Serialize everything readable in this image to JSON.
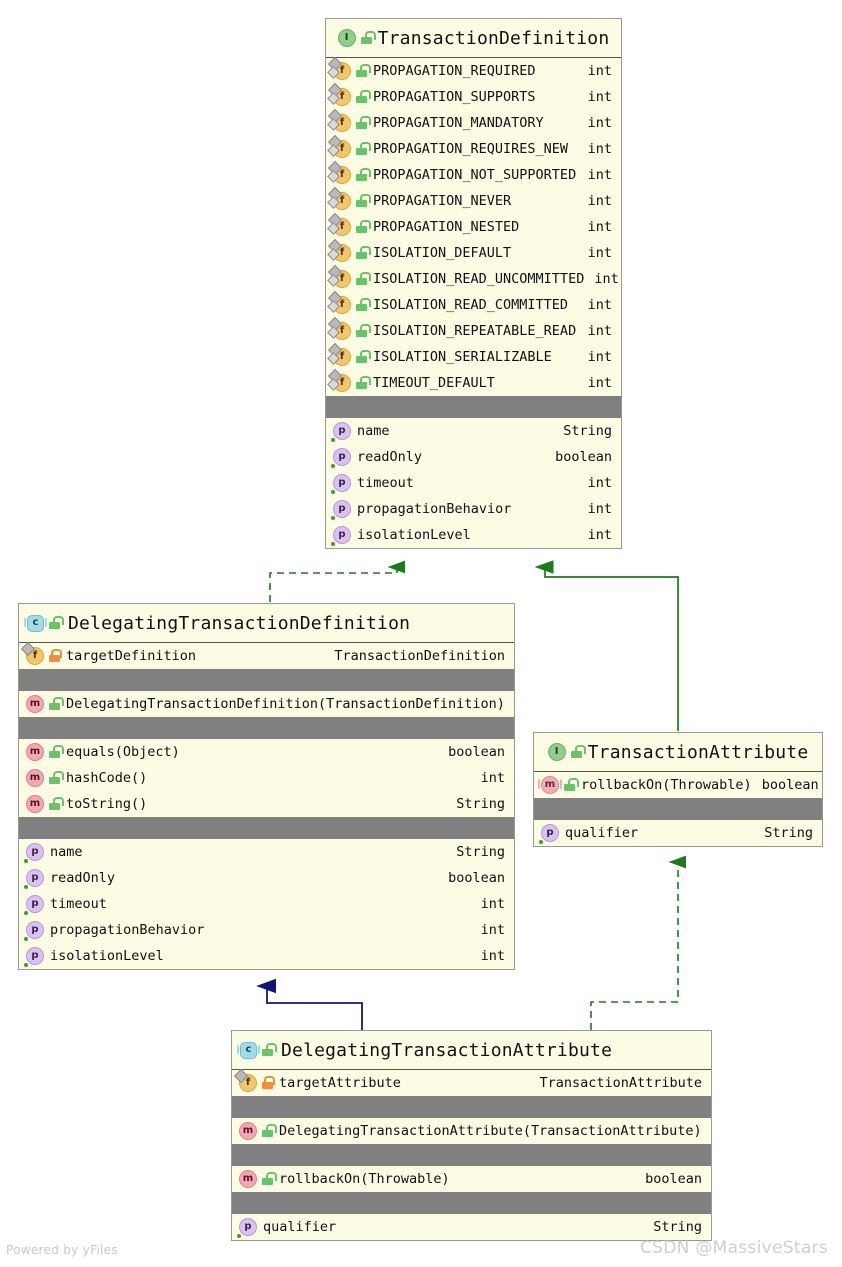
{
  "diagram": {
    "kind": "uml-class-diagram",
    "watermark_left": "Powered by yFiles",
    "watermark_right": "CSDN @MassiveStars",
    "colors": {
      "box_fill": "#fcfce4",
      "box_border": "#9a9a8f",
      "separator_bar": "#808080",
      "interface_icon": "#8fcf8a",
      "class_icon": "#9fdce8",
      "field_icon": "#f3c66a",
      "method_icon": "#f3a7b4",
      "property_icon": "#d9c2ef",
      "public_lock": "#6cc26c",
      "protected_lock": "#ef8f3c",
      "realization_edge": "#1d7a1d",
      "generalization_edge": "#141478"
    }
  },
  "nodes": {
    "transaction_definition": {
      "stereotype": "interface",
      "icon": "interface-icon",
      "visibility": "public",
      "name": "TransactionDefinition",
      "fields": [
        {
          "icon": "static-field-icon",
          "visibility": "public",
          "name": "PROPAGATION_REQUIRED",
          "type": "int"
        },
        {
          "icon": "static-field-icon",
          "visibility": "public",
          "name": "PROPAGATION_SUPPORTS",
          "type": "int"
        },
        {
          "icon": "static-field-icon",
          "visibility": "public",
          "name": "PROPAGATION_MANDATORY",
          "type": "int"
        },
        {
          "icon": "static-field-icon",
          "visibility": "public",
          "name": "PROPAGATION_REQUIRES_NEW",
          "type": "int"
        },
        {
          "icon": "static-field-icon",
          "visibility": "public",
          "name": "PROPAGATION_NOT_SUPPORTED",
          "type": "int"
        },
        {
          "icon": "static-field-icon",
          "visibility": "public",
          "name": "PROPAGATION_NEVER",
          "type": "int"
        },
        {
          "icon": "static-field-icon",
          "visibility": "public",
          "name": "PROPAGATION_NESTED",
          "type": "int"
        },
        {
          "icon": "static-field-icon",
          "visibility": "public",
          "name": "ISOLATION_DEFAULT",
          "type": "int"
        },
        {
          "icon": "static-field-icon",
          "visibility": "public",
          "name": "ISOLATION_READ_UNCOMMITTED",
          "type": "int"
        },
        {
          "icon": "static-field-icon",
          "visibility": "public",
          "name": "ISOLATION_READ_COMMITTED",
          "type": "int"
        },
        {
          "icon": "static-field-icon",
          "visibility": "public",
          "name": "ISOLATION_REPEATABLE_READ",
          "type": "int"
        },
        {
          "icon": "static-field-icon",
          "visibility": "public",
          "name": "ISOLATION_SERIALIZABLE",
          "type": "int"
        },
        {
          "icon": "static-field-icon",
          "visibility": "public",
          "name": "TIMEOUT_DEFAULT",
          "type": "int"
        }
      ],
      "properties": [
        {
          "icon": "property-icon",
          "name": "name",
          "type": "String"
        },
        {
          "icon": "property-icon",
          "name": "readOnly",
          "type": "boolean"
        },
        {
          "icon": "property-icon",
          "name": "timeout",
          "type": "int"
        },
        {
          "icon": "property-icon",
          "name": "propagationBehavior",
          "type": "int"
        },
        {
          "icon": "property-icon",
          "name": "isolationLevel",
          "type": "int"
        }
      ]
    },
    "delegating_transaction_definition": {
      "stereotype": "class",
      "icon": "class-icon",
      "visibility": "public",
      "name": "DelegatingTransactionDefinition",
      "fields": [
        {
          "icon": "field-icon",
          "visibility": "protected",
          "name": "targetDefinition",
          "type": "TransactionDefinition"
        }
      ],
      "constructors": [
        {
          "icon": "method-icon",
          "visibility": "public",
          "name": "DelegatingTransactionDefinition(TransactionDefinition)",
          "type": ""
        }
      ],
      "methods": [
        {
          "icon": "method-icon",
          "visibility": "public",
          "name": "equals(Object)",
          "type": "boolean"
        },
        {
          "icon": "method-icon",
          "visibility": "public",
          "name": "hashCode()",
          "type": "int"
        },
        {
          "icon": "method-icon",
          "visibility": "public",
          "name": "toString()",
          "type": "String"
        }
      ],
      "properties": [
        {
          "icon": "property-icon",
          "name": "name",
          "type": "String"
        },
        {
          "icon": "property-icon",
          "name": "readOnly",
          "type": "boolean"
        },
        {
          "icon": "property-icon",
          "name": "timeout",
          "type": "int"
        },
        {
          "icon": "property-icon",
          "name": "propagationBehavior",
          "type": "int"
        },
        {
          "icon": "property-icon",
          "name": "isolationLevel",
          "type": "int"
        }
      ]
    },
    "transaction_attribute": {
      "stereotype": "interface",
      "icon": "interface-icon",
      "visibility": "public",
      "name": "TransactionAttribute",
      "methods": [
        {
          "icon": "abstract-method-icon",
          "visibility": "public",
          "name": "rollbackOn(Throwable)",
          "type": "boolean"
        }
      ],
      "properties": [
        {
          "icon": "property-icon",
          "name": "qualifier",
          "type": "String"
        }
      ]
    },
    "delegating_transaction_attribute": {
      "stereotype": "class",
      "icon": "class-icon",
      "visibility": "public",
      "name": "DelegatingTransactionAttribute",
      "fields": [
        {
          "icon": "field-icon",
          "visibility": "protected",
          "name": "targetAttribute",
          "type": "TransactionAttribute"
        }
      ],
      "constructors": [
        {
          "icon": "method-icon",
          "visibility": "public",
          "name": "DelegatingTransactionAttribute(TransactionAttribute)",
          "type": ""
        }
      ],
      "methods": [
        {
          "icon": "method-icon",
          "visibility": "public",
          "name": "rollbackOn(Throwable)",
          "type": "boolean"
        }
      ],
      "properties": [
        {
          "icon": "property-icon",
          "name": "qualifier",
          "type": "String"
        }
      ]
    }
  },
  "edges": [
    {
      "from": "delegating_transaction_definition",
      "to": "transaction_definition",
      "type": "realization",
      "style": "dashed",
      "color": "#1d7a1d"
    },
    {
      "from": "transaction_attribute",
      "to": "transaction_definition",
      "type": "generalization",
      "style": "solid",
      "color": "#1d7a1d"
    },
    {
      "from": "delegating_transaction_attribute",
      "to": "delegating_transaction_definition",
      "type": "generalization",
      "style": "solid",
      "color": "#141478"
    },
    {
      "from": "delegating_transaction_attribute",
      "to": "transaction_attribute",
      "type": "realization",
      "style": "dashed",
      "color": "#1d7a1d"
    }
  ]
}
